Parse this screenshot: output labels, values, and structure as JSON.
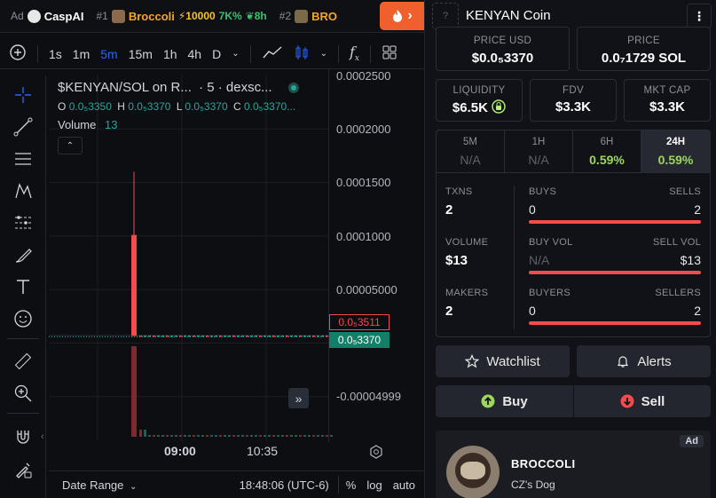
{
  "ticker": {
    "ad_label": "Ad",
    "ad_name": "CaspAI",
    "rank1": "#1",
    "name1": "Broccoli",
    "boost1": "10000",
    "change1": "7K%",
    "age1": "8h",
    "rank2": "#2",
    "name2": "BRO"
  },
  "toolbar": {
    "intervals": [
      "1s",
      "1m",
      "5m",
      "15m",
      "1h",
      "4h",
      "D"
    ],
    "active_interval": "5m"
  },
  "legend": {
    "title": "$KENYAN/SOL on R...",
    "interval": "· 5 · dexsc...",
    "o_label": "O",
    "o_val": "0.0₅3350",
    "h_label": "H",
    "h_val": "0.0₅3370",
    "l_label": "L",
    "l_val": "0.0₅3370",
    "c_label": "C",
    "c_val": "0.0₅3370...",
    "volume_label": "Volume",
    "volume_val": "13"
  },
  "price_scale": {
    "labels": [
      "0.0002500",
      "0.0002000",
      "0.0001500",
      "0.0001000",
      "0.00005000",
      "-0.00004999"
    ],
    "marker_high": "0.0₅3511",
    "marker_current": "0.0₅3370"
  },
  "time_axis": {
    "labels": [
      "09:00",
      "10:35"
    ]
  },
  "bottom_bar": {
    "date_range": "Date Range",
    "clock": "18:48:06 (UTC-6)",
    "percent": "%",
    "log": "log",
    "auto": "auto"
  },
  "token": {
    "name": "KENYAN Coin",
    "icon_placeholder": "?"
  },
  "prices": {
    "usd_label": "PRICE USD",
    "usd_val": "$0.0₅3370",
    "sol_label": "PRICE",
    "sol_val": "0.0₇1729 SOL"
  },
  "metrics": [
    {
      "label": "LIQUIDITY",
      "value": "$6.5K"
    },
    {
      "label": "FDV",
      "value": "$3.3K"
    },
    {
      "label": "MKT CAP",
      "value": "$3.3K"
    }
  ],
  "timeframes": [
    {
      "label": "5M",
      "value": "N/A"
    },
    {
      "label": "1H",
      "value": "N/A"
    },
    {
      "label": "6H",
      "value": "0.59%"
    },
    {
      "label": "24H",
      "value": "0.59%"
    }
  ],
  "stats": {
    "txns_label": "TXNS",
    "txns_val": "2",
    "buys_label": "BUYS",
    "buys_val": "0",
    "sells_label": "SELLS",
    "sells_val": "2",
    "volume_label": "VOLUME",
    "volume_val": "$13",
    "buyvol_label": "BUY VOL",
    "buyvol_val": "N/A",
    "sellvol_label": "SELL VOL",
    "sellvol_val": "$13",
    "makers_label": "MAKERS",
    "makers_val": "2",
    "buyers_label": "BUYERS",
    "buyers_val": "0",
    "sellers_label": "SELLERS",
    "sellers_val": "2"
  },
  "actions": {
    "watchlist": "Watchlist",
    "alerts": "Alerts",
    "buy": "Buy",
    "sell": "Sell"
  },
  "promo": {
    "ad_badge": "Ad",
    "title": "BROCCOLI",
    "subtitle": "CZ's Dog"
  },
  "chart_data": {
    "type": "candlestick",
    "ylim": [
      -6e-05,
      0.00026
    ],
    "grid": true,
    "x_ticks": [
      "09:00",
      "10:35"
    ],
    "candles": [
      {
        "open": 3.37e-06,
        "high": 0.00016,
        "low": 3.37e-06,
        "close": 3.511e-06
      },
      {
        "open": 3.511e-06,
        "high": 3.511e-06,
        "low": 3.37e-06,
        "close": 3.37e-06
      }
    ],
    "colors": {
      "up": "#26a69a",
      "down": "#f44c4c"
    }
  }
}
